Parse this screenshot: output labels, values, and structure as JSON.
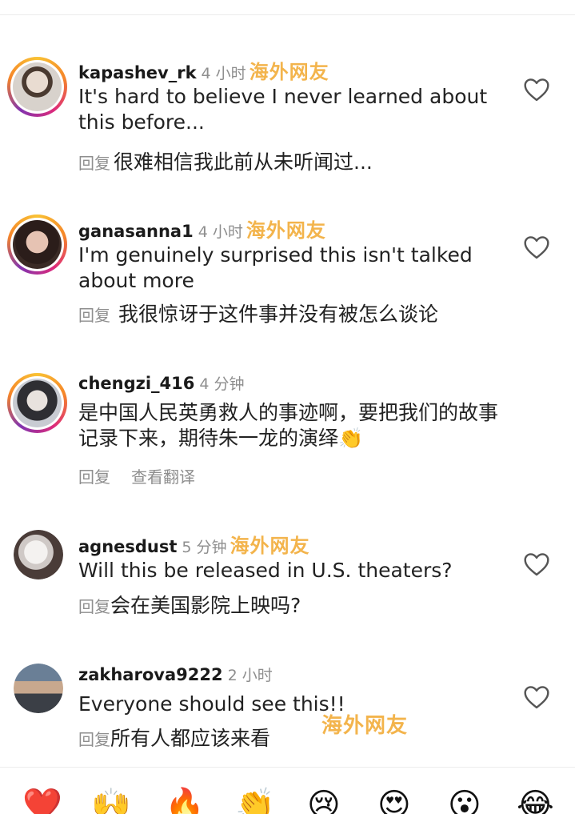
{
  "comments": [
    {
      "username": "kapashev_rk",
      "time": "4 小时",
      "tag": "海外网友",
      "text": "It's hard to believe I never learned about this before...",
      "reply": "回复",
      "translation": "很难相信我此前从未听闻过..."
    },
    {
      "username": "ganasanna1",
      "time": "4 小时",
      "tag": "海外网友",
      "text": "I'm genuinely surprised this isn't talked about more",
      "reply": "回复",
      "translation": "我很惊讶于这件事并没有被怎么谈论"
    },
    {
      "username": "chengzi_416",
      "time": "4 分钟",
      "text": "是中国人民英勇救人的事迹啊，要把我们的故事记录下来，期待朱一龙的演绎👏",
      "reply": "回复",
      "see_translation": "查看翻译"
    },
    {
      "username": "agnesdust",
      "time": "5 分钟",
      "tag": "海外网友",
      "text": "Will this be released in U.S. theaters?",
      "reply": "回复",
      "translation": "会在美国影院上映吗?"
    },
    {
      "username": "zakharova9222",
      "time": "2 小时",
      "text": "Everyone should see this!!",
      "reply": "回复",
      "translation": "所有人都应该来看"
    }
  ],
  "floating_tag": "海外网友",
  "emoji_bar": [
    "❤️",
    "🙌",
    "🔥",
    "👏",
    "😢",
    "😍",
    "😮",
    "😂"
  ],
  "icons": {
    "like": "heart-outline-icon"
  }
}
